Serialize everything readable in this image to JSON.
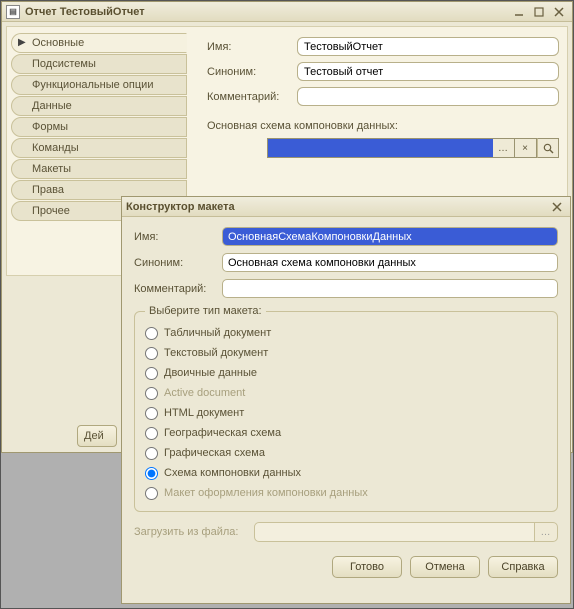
{
  "window": {
    "title": "Отчет ТестовыйОтчет",
    "icon": "report-icon"
  },
  "sidebar": {
    "items": [
      {
        "label": "Основные",
        "active": true
      },
      {
        "label": "Подсистемы"
      },
      {
        "label": "Функциональные опции"
      },
      {
        "label": "Данные"
      },
      {
        "label": "Формы"
      },
      {
        "label": "Команды"
      },
      {
        "label": "Макеты"
      },
      {
        "label": "Права"
      },
      {
        "label": "Прочее"
      }
    ]
  },
  "form": {
    "name_label": "Имя:",
    "name_value": "ТестовыйОтчет",
    "synonym_label": "Синоним:",
    "synonym_value": "Тестовый отчет",
    "comment_label": "Комментарий:",
    "comment_value": "",
    "schema_label": "Основная схема компоновки данных:",
    "schema_value": "",
    "clear_btn": "×",
    "pick_btn": "…",
    "magnifier_btn": "magnifier-icon"
  },
  "actions_button": "Дей",
  "modal": {
    "title": "Конструктор макета",
    "name_label": "Имя:",
    "name_value": "ОсновнаяСхемаКомпоновкиДанных",
    "synonym_label": "Синоним:",
    "synonym_value": "Основная схема компоновки данных",
    "comment_label": "Комментарий:",
    "comment_value": "",
    "group_legend": "Выберите тип макета:",
    "options": [
      {
        "label": "Табличный документ",
        "checked": false
      },
      {
        "label": "Текстовый документ",
        "checked": false
      },
      {
        "label": "Двоичные данные",
        "checked": false
      },
      {
        "label": "Active document",
        "checked": false
      },
      {
        "label": "HTML документ",
        "checked": false
      },
      {
        "label": "Географическая схема",
        "checked": false
      },
      {
        "label": "Графическая схема",
        "checked": false
      },
      {
        "label": "Схема компоновки данных",
        "checked": true
      },
      {
        "label": "Макет оформления компоновки данных",
        "checked": false
      }
    ],
    "file_label": "Загрузить из файла:",
    "file_btn": "…",
    "buttons": {
      "ok": "Готово",
      "cancel": "Отмена",
      "help": "Справка"
    }
  }
}
